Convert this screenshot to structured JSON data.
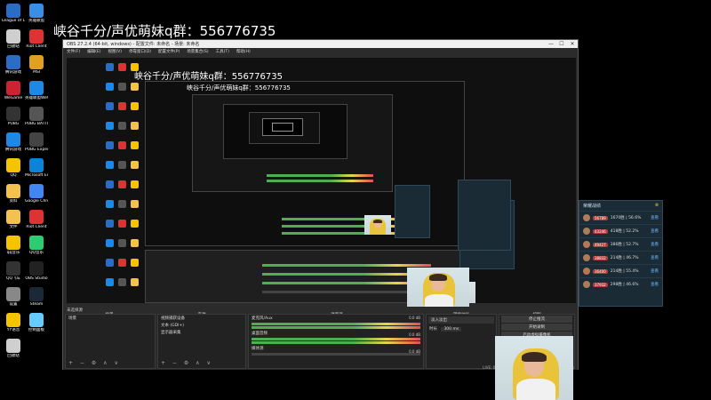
{
  "overlay": {
    "title": "峡谷千分/声优萌妹q群：556776735",
    "title_small": "峡谷千分/声优萌妹q群：556776735",
    "title_tiny": "峡谷千分/声优萌妹q群：556776735"
  },
  "desktop_icons": [
    {
      "label": "League of Legends"
    },
    {
      "label": "英雄联盟"
    },
    {
      "label": "回收站"
    },
    {
      "label": "Riot Client"
    },
    {
      "label": "腾讯游戏"
    },
    {
      "label": "MSI"
    },
    {
      "label": "WeGame"
    },
    {
      "label": "英雄联盟WeGame版"
    },
    {
      "label": "PUBG"
    },
    {
      "label": "PUBG BATTLEGROUNDS"
    },
    {
      "label": "腾讯游戏"
    },
    {
      "label": "PUBG Experimental"
    },
    {
      "label": "QQ"
    },
    {
      "label": "Microsoft Edge"
    },
    {
      "label": "资料"
    },
    {
      "label": "Google Chrome"
    },
    {
      "label": "文件"
    },
    {
      "label": "Riot Client"
    },
    {
      "label": "qq音乐"
    },
    {
      "label": "QQ音乐"
    },
    {
      "label": "QQ飞车"
    },
    {
      "label": "OBS Studio"
    },
    {
      "label": "设置"
    },
    {
      "label": "Steam"
    },
    {
      "label": "YY语音"
    },
    {
      "label": "控制面板"
    },
    {
      "label": "回收站"
    }
  ],
  "obs": {
    "window_title": "OBS 27.2.4 (64-bit, windows) - 配置文件: 未命名 - 场景: 未命名",
    "menu": [
      "文件(F)",
      "编辑(E)",
      "视图(V)",
      "停靠窗口(D)",
      "配置文件(P)",
      "场景集合(S)",
      "工具(T)",
      "帮助(H)"
    ],
    "win_controls": [
      "—",
      "☐",
      "✕"
    ],
    "current_source": "未选择源",
    "docks": {
      "scenes": {
        "title": "场景",
        "items": [
          "场景"
        ]
      },
      "sources": {
        "title": "来源",
        "items": [
          "视频捕获设备",
          "文本 (GDI+)",
          "显示器采集"
        ]
      },
      "mixer": {
        "title": "混音器",
        "channels": [
          {
            "name": "麦克风/Aux",
            "level": "0.0 dB"
          },
          {
            "name": "桌面音频",
            "level": "0.0 dB"
          },
          {
            "name": "媒体源",
            "level": "0.0 dB"
          }
        ]
      },
      "transitions": {
        "title": "转场动画",
        "type": "淡入淡出",
        "duration_label": "时长",
        "duration": "300 ms"
      },
      "controls": {
        "title": "控制",
        "buttons": [
          "停止推流",
          "开始录制",
          "启动虚拟摄像机",
          "工作室模式",
          "设置",
          "退出"
        ]
      }
    },
    "tool_glyphs": "+ − ⚙ ∧ ∨",
    "statusbar": "LIVE: 00:00:00  REC: 00:00:00  CPU: 3.4%, 30.00 fps"
  },
  "rank_panel_large": {
    "title": "荣耀战绩",
    "rows": [
      {
        "badge": "56789",
        "stat": "1670胜 | 56.6%",
        "link": "查看"
      },
      {
        "badge": "43246",
        "stat": "418胜 | 52.2%",
        "link": "查看"
      },
      {
        "badge": "49427",
        "stat": "386胜 | 52.7%",
        "link": "查看"
      },
      {
        "badge": "38832",
        "stat": "214胜 | 46.7%",
        "link": "查看"
      },
      {
        "badge": "36400",
        "stat": "214胜 | 55.4%",
        "link": "查看"
      },
      {
        "badge": "37932",
        "stat": "298胜 | 46.6%",
        "link": "查看"
      }
    ]
  },
  "colors": {
    "obs_bg": "#2b2b2b",
    "panel_bg": "#1b2b36",
    "chair_yellow": "#e9c43a",
    "link_blue": "#6ab7ff"
  }
}
